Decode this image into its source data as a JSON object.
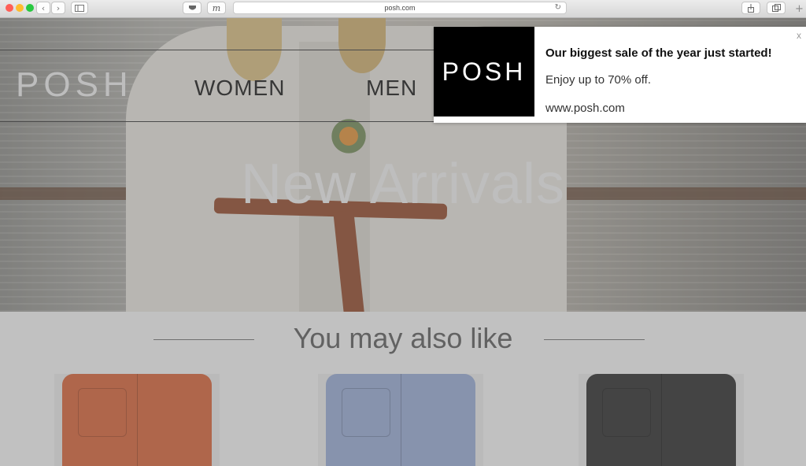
{
  "browser": {
    "url": "posh.com",
    "icons": {
      "back": "chevron-left-icon",
      "forward": "chevron-right-icon",
      "sidebar": "sidebar-icon",
      "pocket": "pocket-icon",
      "extension": "m-extension-icon",
      "reload": "reload-icon",
      "share": "share-icon",
      "tabs": "tabs-icon",
      "new_tab": "plus-icon"
    },
    "traffic_lights": {
      "close": "#ff5f57",
      "minimize": "#febc2e",
      "zoom": "#28c840"
    },
    "extension_label": "m",
    "reload_glyph": "↻",
    "new_tab_glyph": "+"
  },
  "site": {
    "logo": "POSH",
    "nav": [
      {
        "label": "WOMEN"
      },
      {
        "label": "MEN"
      }
    ],
    "hero_title": "New Arrivals",
    "related_title": "You may also like",
    "products": [
      {
        "color": "#d9704a"
      },
      {
        "color": "#9fb0d6"
      },
      {
        "color": "#3f3f3f"
      }
    ]
  },
  "notification": {
    "logo": "POSH",
    "title": "Our biggest sale of the year just started!",
    "body": "Enjoy up to 70% off.",
    "link": "www.posh.com",
    "close": "x"
  }
}
